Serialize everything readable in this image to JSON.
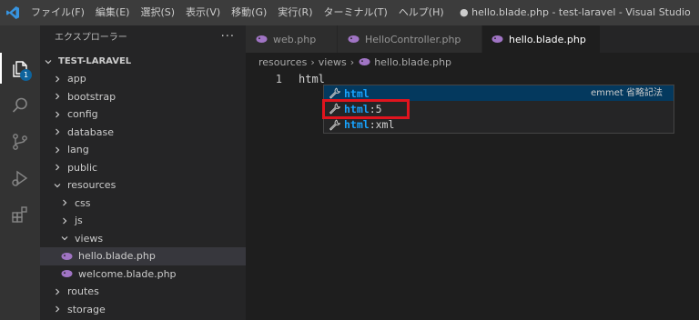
{
  "menu": [
    "ファイル(F)",
    "編集(E)",
    "選択(S)",
    "表示(V)",
    "移動(G)",
    "実行(R)",
    "ターミナル(T)",
    "ヘルプ(H)"
  ],
  "window_title": "● hello.blade.php - test-laravel - Visual Studio",
  "activity_bar": {
    "items": [
      "explorer-icon",
      "search-icon",
      "source-control-icon",
      "run-debug-icon",
      "extensions-icon"
    ],
    "badge": "1"
  },
  "sidebar": {
    "title": "エクスプローラー",
    "more": "···",
    "section": "TEST-LARAVEL",
    "tree": [
      {
        "label": "app",
        "indent": 1,
        "kind": "folder",
        "open": false
      },
      {
        "label": "bootstrap",
        "indent": 1,
        "kind": "folder",
        "open": false
      },
      {
        "label": "config",
        "indent": 1,
        "kind": "folder",
        "open": false
      },
      {
        "label": "database",
        "indent": 1,
        "kind": "folder",
        "open": false
      },
      {
        "label": "lang",
        "indent": 1,
        "kind": "folder",
        "open": false
      },
      {
        "label": "public",
        "indent": 1,
        "kind": "folder",
        "open": false
      },
      {
        "label": "resources",
        "indent": 1,
        "kind": "folder",
        "open": true
      },
      {
        "label": "css",
        "indent": 2,
        "kind": "folder",
        "open": false
      },
      {
        "label": "js",
        "indent": 2,
        "kind": "folder",
        "open": false
      },
      {
        "label": "views",
        "indent": 2,
        "kind": "folder",
        "open": true
      },
      {
        "label": "hello.blade.php",
        "indent": 3,
        "kind": "file",
        "selected": true
      },
      {
        "label": "welcome.blade.php",
        "indent": 3,
        "kind": "file"
      },
      {
        "label": "routes",
        "indent": 1,
        "kind": "folder",
        "open": false
      },
      {
        "label": "storage",
        "indent": 1,
        "kind": "folder",
        "open": false
      }
    ]
  },
  "tabs": [
    {
      "label": "web.php",
      "active": false
    },
    {
      "label": "HelloController.php",
      "active": false
    },
    {
      "label": "hello.blade.php",
      "active": true,
      "dirty": true
    }
  ],
  "breadcrumb": [
    "resources",
    "views",
    "hello.blade.php"
  ],
  "editor": {
    "line_number": "1",
    "code": "html"
  },
  "suggestions": [
    {
      "match": "html",
      "rest": "",
      "detail": "emmet 省略記法",
      "focused": true
    },
    {
      "match": "html",
      "rest": ":5",
      "detail": "",
      "highlighted": true
    },
    {
      "match": "html",
      "rest": ":xml",
      "detail": ""
    }
  ],
  "colors": {
    "php_icon": "#a074c4",
    "match": "#18a3ff",
    "highlight_box": "#e0141e",
    "accent": "#0e639c"
  }
}
